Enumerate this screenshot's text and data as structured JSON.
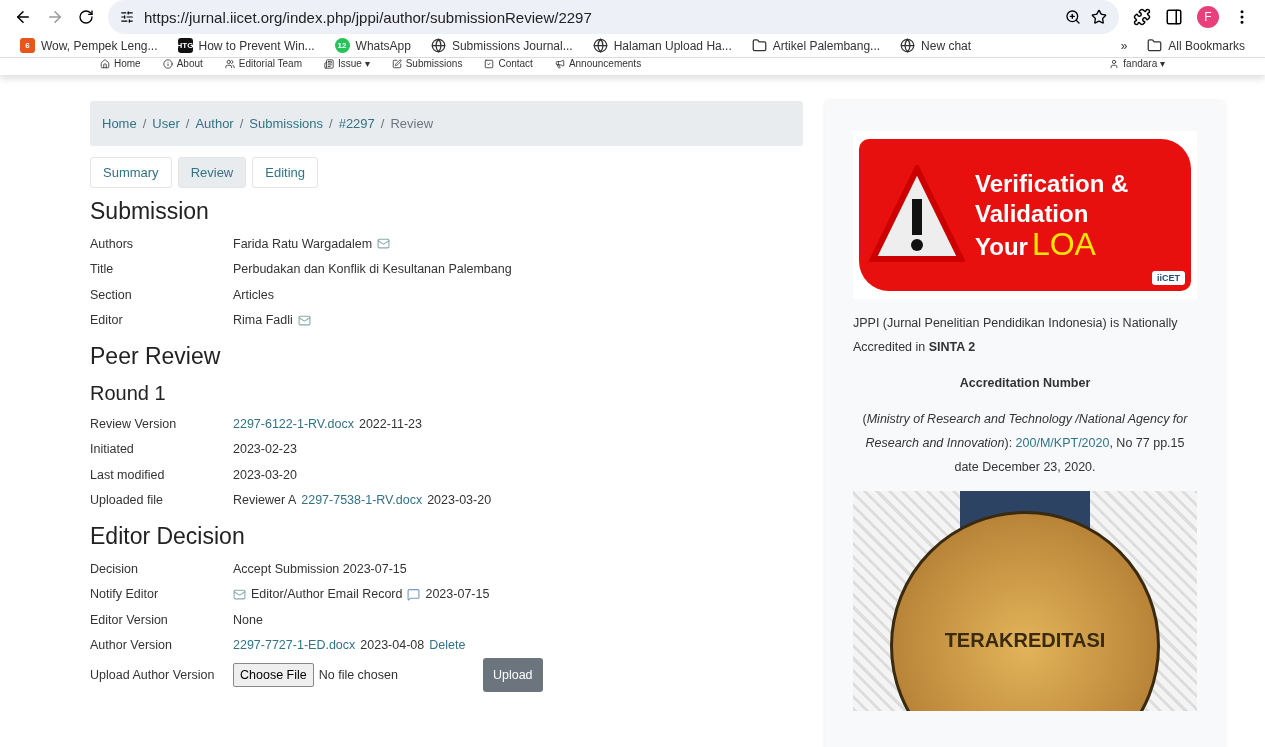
{
  "browser": {
    "url": "https://jurnal.iicet.org/index.php/jppi/author/submissionReview/2297",
    "profile_initial": "F",
    "bookmarks": [
      {
        "label": "Wow, Pempek Leng...",
        "kind": "six",
        "icon_text": "6"
      },
      {
        "label": "How to Prevent Win...",
        "kind": "htg",
        "icon_text": "HTG"
      },
      {
        "label": "WhatsApp",
        "kind": "whatsapp",
        "icon_text": "12"
      },
      {
        "label": "Submissions Journal...",
        "kind": "globe"
      },
      {
        "label": "Halaman Upload Ha...",
        "kind": "globe"
      },
      {
        "label": "Artikel Palembang...",
        "kind": "folder"
      },
      {
        "label": "New chat",
        "kind": "globe"
      }
    ],
    "overflow": "»",
    "all_bookmarks": "All Bookmarks"
  },
  "site_nav": {
    "items": [
      "Home",
      "About",
      "Editorial Team",
      "Issue ▾",
      "Submissions",
      "Contact",
      "Announcements"
    ],
    "user": "fandara ▾"
  },
  "breadcrumb_separator": "/",
  "breadcrumb": [
    {
      "label": "Home",
      "current": false
    },
    {
      "label": "User",
      "current": false
    },
    {
      "label": "Author",
      "current": false
    },
    {
      "label": "Submissions",
      "current": false
    },
    {
      "label": "#2297",
      "current": false
    },
    {
      "label": "Review",
      "current": true
    }
  ],
  "tabs": [
    {
      "label": "Summary",
      "selected": false
    },
    {
      "label": "Review",
      "selected": true
    },
    {
      "label": "Editing",
      "selected": false
    }
  ],
  "sections": [
    {
      "heading": "Submission",
      "kind": "heading",
      "rows": [
        {
          "label": "Authors",
          "parts": [
            {
              "kind": "text",
              "text": "Farida Ratu Wargadalem"
            },
            {
              "kind": "mail"
            }
          ]
        },
        {
          "label": "Title",
          "parts": [
            {
              "kind": "text",
              "text": "Perbudakan dan Konflik di Kesultanan Palembang"
            }
          ]
        },
        {
          "label": "Section",
          "parts": [
            {
              "kind": "text",
              "text": "Articles"
            }
          ]
        },
        {
          "label": "Editor",
          "parts": [
            {
              "kind": "text",
              "text": "Rima Fadli"
            },
            {
              "kind": "mail"
            }
          ]
        }
      ]
    },
    {
      "heading": "Peer Review",
      "kind": "heading"
    },
    {
      "heading": "Round 1",
      "kind": "subheading",
      "rows": [
        {
          "label": "Review Version",
          "parts": [
            {
              "kind": "link",
              "text": "2297-6122-1-RV.docx"
            },
            {
              "kind": "text",
              "text": "2022-11-23"
            }
          ]
        },
        {
          "label": "Initiated",
          "parts": [
            {
              "kind": "text",
              "text": "2023-02-23"
            }
          ]
        },
        {
          "label": "Last modified",
          "parts": [
            {
              "kind": "text",
              "text": "2023-03-20"
            }
          ]
        },
        {
          "label": "Uploaded file",
          "parts": [
            {
              "kind": "text",
              "text": "Reviewer A"
            },
            {
              "kind": "link",
              "text": "2297-7538-1-RV.docx"
            },
            {
              "kind": "text",
              "text": "2023-03-20"
            }
          ]
        }
      ]
    },
    {
      "heading": "Editor Decision",
      "kind": "heading",
      "rows": [
        {
          "label": "Decision",
          "parts": [
            {
              "kind": "text",
              "text": "Accept Submission 2023-07-15"
            }
          ]
        },
        {
          "label": "Notify Editor",
          "parts": [
            {
              "kind": "mail"
            },
            {
              "kind": "text",
              "text": "Editor/Author Email Record"
            },
            {
              "kind": "comment"
            },
            {
              "kind": "text",
              "text": "2023-07-15"
            }
          ]
        },
        {
          "label": "Editor Version",
          "parts": [
            {
              "kind": "text",
              "text": "None"
            }
          ]
        },
        {
          "label": "Author Version",
          "parts": [
            {
              "kind": "link",
              "text": "2297-7727-1-ED.docx"
            },
            {
              "kind": "text",
              "text": "2023-04-08"
            },
            {
              "kind": "link",
              "text": "Delete"
            }
          ]
        },
        {
          "label": "Upload Author Version",
          "parts": [
            {
              "kind": "file",
              "text": "Choose File",
              "note": "No file chosen"
            },
            {
              "kind": "button",
              "text": "Upload"
            }
          ]
        }
      ]
    }
  ],
  "sidebar": {
    "banner": {
      "line1": "Verification",
      "amp": "&",
      "line2": "Validation",
      "line3": "Your",
      "loa": "LOA",
      "logo": "iiCET"
    },
    "accreditation": "JPPI (Jurnal Penelitian Pendidikan Indonesia) is Nationally Accredited in **SINTA 2**",
    "number_title": "Accreditation Number",
    "ministry": "(*Ministry of Research and Technology /National Agency for Research and Innovation*):",
    "decree_link": "200/M/KPT/2020",
    "decree_rest": ", No 77 pp.15 date December 23, 2020.",
    "seal_text": "TERAKREDITASI"
  }
}
